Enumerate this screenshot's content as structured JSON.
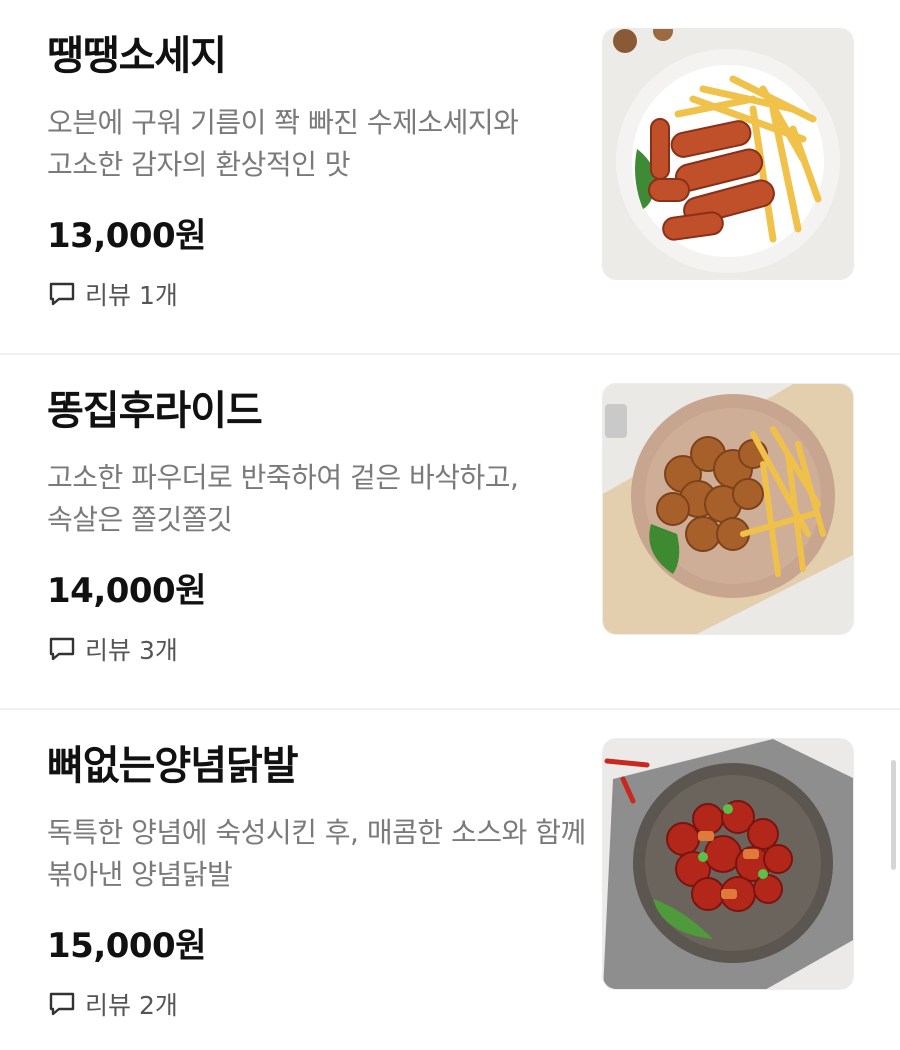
{
  "menu": {
    "items": [
      {
        "name": "땡땡소세지",
        "description": "오븐에 구워 기름이 쫙 빠진 수제소세지와 고소한 감자의 환상적인 맛",
        "price": "13,000원",
        "review_label": "리뷰",
        "review_count": "1개",
        "image_icon": "sausage-fries-plate"
      },
      {
        "name": "똥집후라이드",
        "description": "고소한 파우더로 반죽하여 겉은 바삭하고, 속살은 쫄깃쫄깃",
        "price": "14,000원",
        "review_label": "리뷰",
        "review_count": "3개",
        "image_icon": "fried-gizzard-fries-plate"
      },
      {
        "name": "뼈없는양념닭발",
        "description": "독특한 양념에 숙성시킨 후, 매콤한 소스와 함께 볶아낸 양념닭발",
        "price": "15,000원",
        "review_label": "리뷰",
        "review_count": "2개",
        "image_icon": "spicy-chicken-feet-plate"
      }
    ]
  },
  "colors": {
    "title": "#111111",
    "description": "#7a7a7a",
    "divider": "#f0f0f0",
    "review": "#555555"
  }
}
